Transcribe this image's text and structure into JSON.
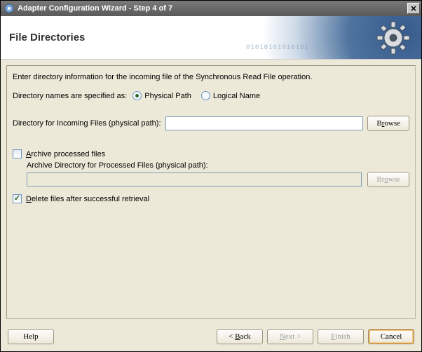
{
  "titlebar": {
    "title": "Adapter Configuration Wizard - Step 4 of 7"
  },
  "header": {
    "title": "File Directories"
  },
  "content": {
    "instruction": "Enter directory information for the incoming file of the Synchronous Read File operation.",
    "dirnames_label": "Directory names are specified as:",
    "radio_physical": "Physical Path",
    "radio_logical": "Logical Name",
    "radio_selected": "physical",
    "incoming_label": "Directory for Incoming Files (physical path):",
    "incoming_value": "",
    "browse_label": "Browse",
    "archive_check_label": "Archive processed files",
    "archive_checked": false,
    "archive_dir_label": "Archive Directory for Processed Files (physical path):",
    "archive_dir_value": "",
    "archive_browse_label": "Browse",
    "delete_check_label": "Delete files after successful retrieval",
    "delete_checked": true
  },
  "footer": {
    "help": "Help",
    "back": "< Back",
    "next": "Next >",
    "finish": "Finish",
    "cancel": "Cancel"
  }
}
